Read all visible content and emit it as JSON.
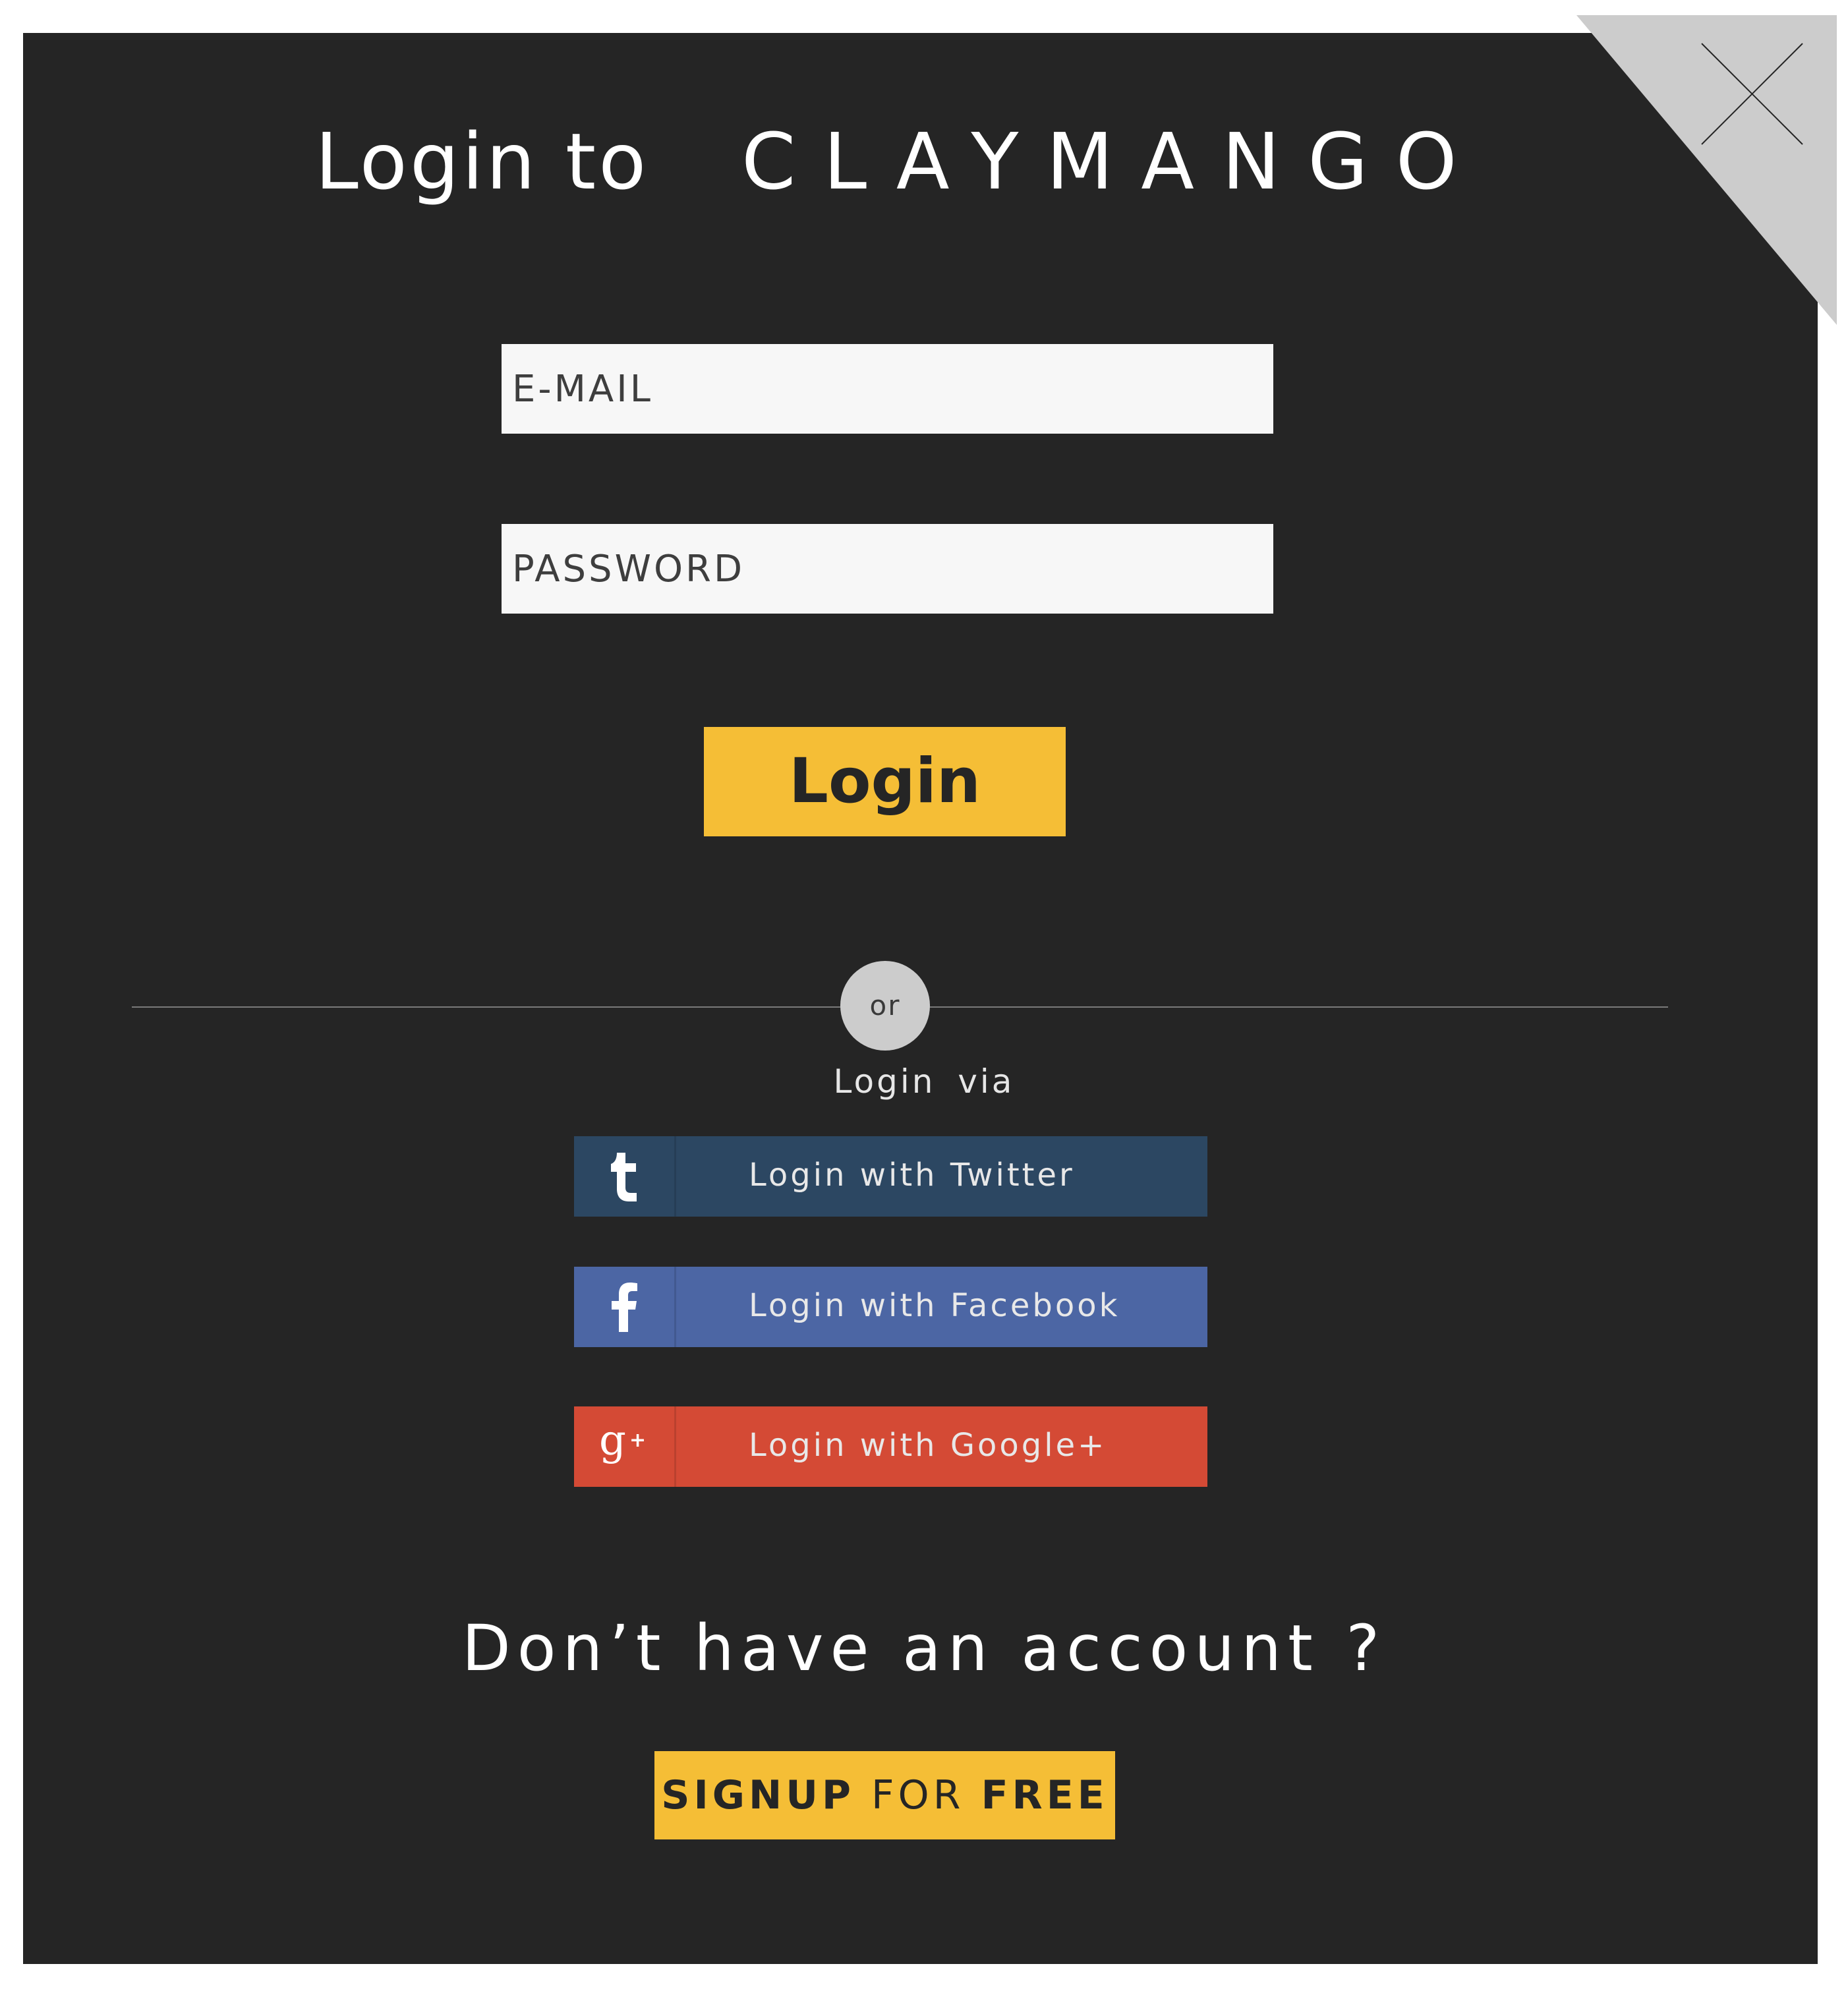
{
  "dialog": {
    "title_prefix": "Login to",
    "brand": "CLAYMANGO",
    "close_icon": "close-icon"
  },
  "form": {
    "email_placeholder": "E-MAIL",
    "password_placeholder": "PASSWORD",
    "login_label": "Login"
  },
  "separator": {
    "or_label": "or",
    "via_label": "Login via"
  },
  "social": [
    {
      "label": "Login with Twitter",
      "icon": "tumblr-t-icon",
      "color": "#2c4762"
    },
    {
      "label": "Login with Facebook",
      "icon": "facebook-f-icon",
      "color": "#4c66a4"
    },
    {
      "label": "Login with Google+",
      "icon": "google-plus-icon",
      "color": "#d44a35"
    }
  ],
  "signup": {
    "prompt": "Don’t have an account ?",
    "part1": "SIGNUP",
    "part2": "FOR",
    "part3": "FREE"
  },
  "colors": {
    "background": "#252525",
    "accent": "#f5be36",
    "field": "#f7f7f7",
    "corner": "#cccccc"
  }
}
